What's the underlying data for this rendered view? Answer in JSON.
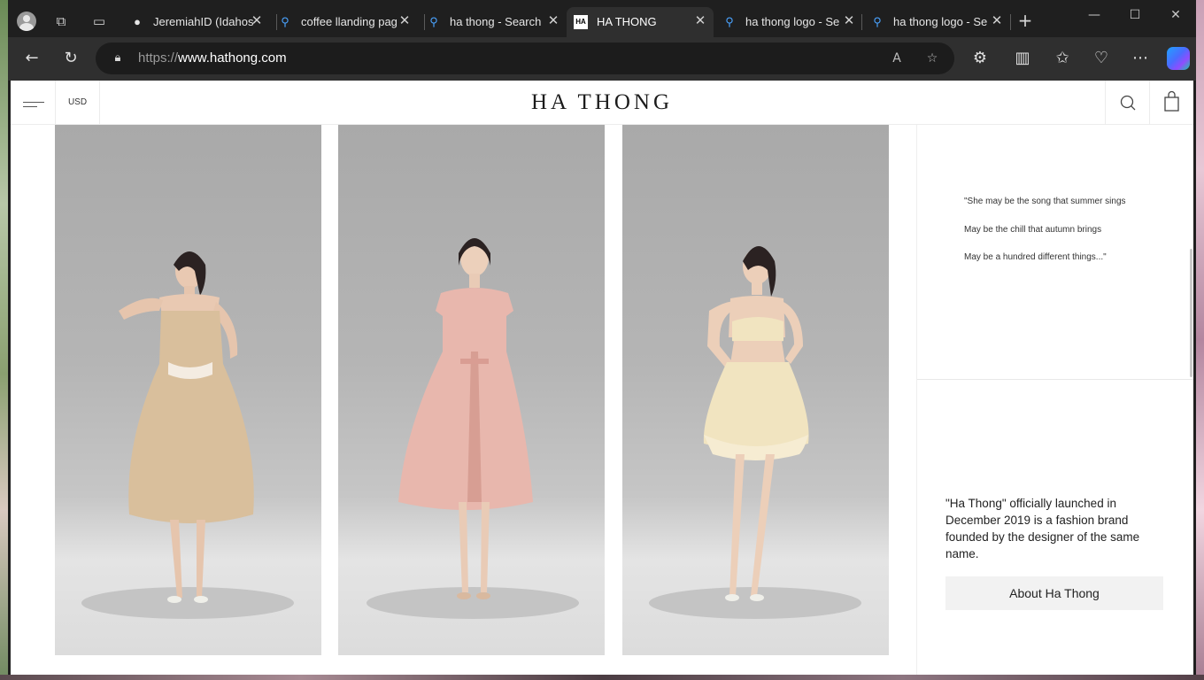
{
  "browser": {
    "tabs": [
      {
        "title": "JeremiahID (Idahos",
        "favicon": "github-icon",
        "active": false
      },
      {
        "title": "coffee llanding pag",
        "favicon": "search-icon",
        "active": false
      },
      {
        "title": "ha thong - Search",
        "favicon": "search-icon",
        "active": false
      },
      {
        "title": "HA THONG",
        "favicon": "ha-logo-icon",
        "active": true
      },
      {
        "title": "ha thong logo - Se",
        "favicon": "search-icon",
        "active": false
      },
      {
        "title": "ha thong logo - Se",
        "favicon": "search-icon",
        "active": false
      }
    ],
    "url_scheme": "https://",
    "url_host": "www.hathong.com"
  },
  "site": {
    "currency": "USD",
    "logo": "HA THONG",
    "quote_lines": [
      "\"She may be the song that summer sings",
      "May be the chill that autumn brings",
      "May be a hundred different things...\""
    ],
    "about_text": "\"Ha Thong\" officially launched in December 2019 is a fashion brand founded by the designer of the same name.",
    "about_button": "About Ha Thong"
  },
  "colors": {
    "browser_dark": "#1f1f1f",
    "toolbar": "#2f2f2f",
    "dress_beige": "#d9bf9c",
    "dress_pink": "#e8b7ad",
    "dress_cream": "#f1e4c0"
  }
}
